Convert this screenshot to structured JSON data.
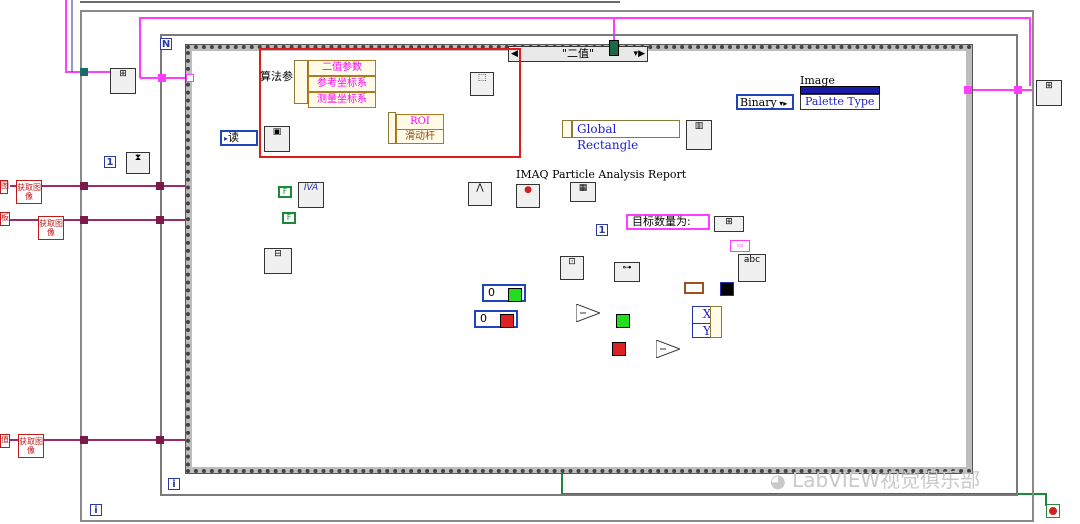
{
  "top_label": "",
  "frames": {
    "while_loop_outer_iter": "i",
    "while_loop_inner_iter": "i",
    "for_loop_count": "N"
  },
  "case_selector": {
    "value": "\"二值\""
  },
  "algorithm_cluster": {
    "label": "算法参",
    "fields": [
      "二值参数",
      "参考坐标系",
      "测量坐标系"
    ],
    "roi_label": "ROI",
    "slider_label": "滑动杆"
  },
  "read_constant": "读",
  "iteration_constant": "1",
  "global_rectangle": "Global Rectangle",
  "image_label": "Image",
  "binary_enum": "Binary",
  "palette_type": "Palette Type",
  "particle_report": "IMAQ Particle Analysis Report",
  "target_count_label": "目标数量为:",
  "index_constant": "1",
  "zero_const_a": "0",
  "zero_const_b": "0",
  "xy_labels": [
    "X",
    "Y"
  ],
  "get_image_labels": [
    "获取图像",
    "获取图像",
    "获取图像"
  ],
  "left_edge_labels": [
    "图",
    "板",
    "值"
  ],
  "colors": {
    "pink_wire": "#ff3cff",
    "blue_wire": "#2233aa",
    "brown_wire": "#a0501e",
    "green_wire": "#1a8a3a",
    "highlight_red": "#e21c1c"
  },
  "watermark": "LabVIEW视觉俱乐部"
}
